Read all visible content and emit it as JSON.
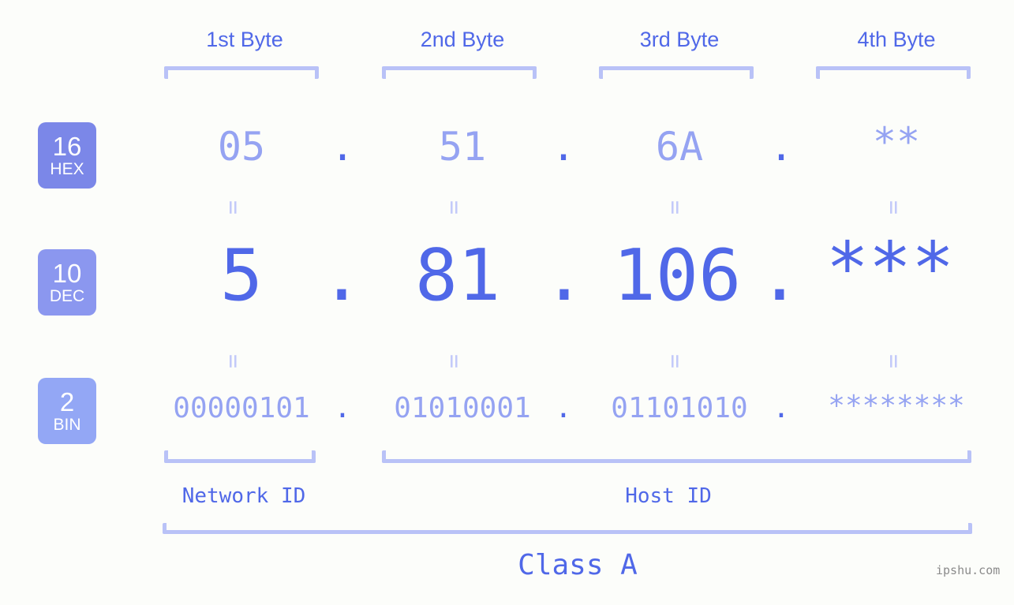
{
  "background": "#fcfdfa",
  "accent": "#5068e8",
  "accent_light": "#95a3f2",
  "bracket_color": "#b9c2f7",
  "header": {
    "bytes": [
      {
        "label": "1st Byte"
      },
      {
        "label": "2nd Byte"
      },
      {
        "label": "3rd Byte"
      },
      {
        "label": "4th Byte"
      }
    ]
  },
  "bases": [
    {
      "number": "16",
      "name": "HEX",
      "color": "#7b87e8"
    },
    {
      "number": "10",
      "name": "DEC",
      "color": "#8b97ef"
    },
    {
      "number": "2",
      "name": "BIN",
      "color": "#93a7f5"
    }
  ],
  "rows": {
    "hex": {
      "values": [
        "05",
        "51",
        "6A",
        "**"
      ],
      "separator": "."
    },
    "dec": {
      "values": [
        "5",
        "81",
        "106",
        "***"
      ],
      "separator": "."
    },
    "bin": {
      "values": [
        "00000101",
        "01010001",
        "01101010",
        "********"
      ],
      "separator": "."
    }
  },
  "connectors": {
    "symbol": "=",
    "count_per_row": 4
  },
  "footer": {
    "network_id_label": "Network ID",
    "host_id_label": "Host ID",
    "class_label": "Class A"
  },
  "watermark": "ipshu.com"
}
